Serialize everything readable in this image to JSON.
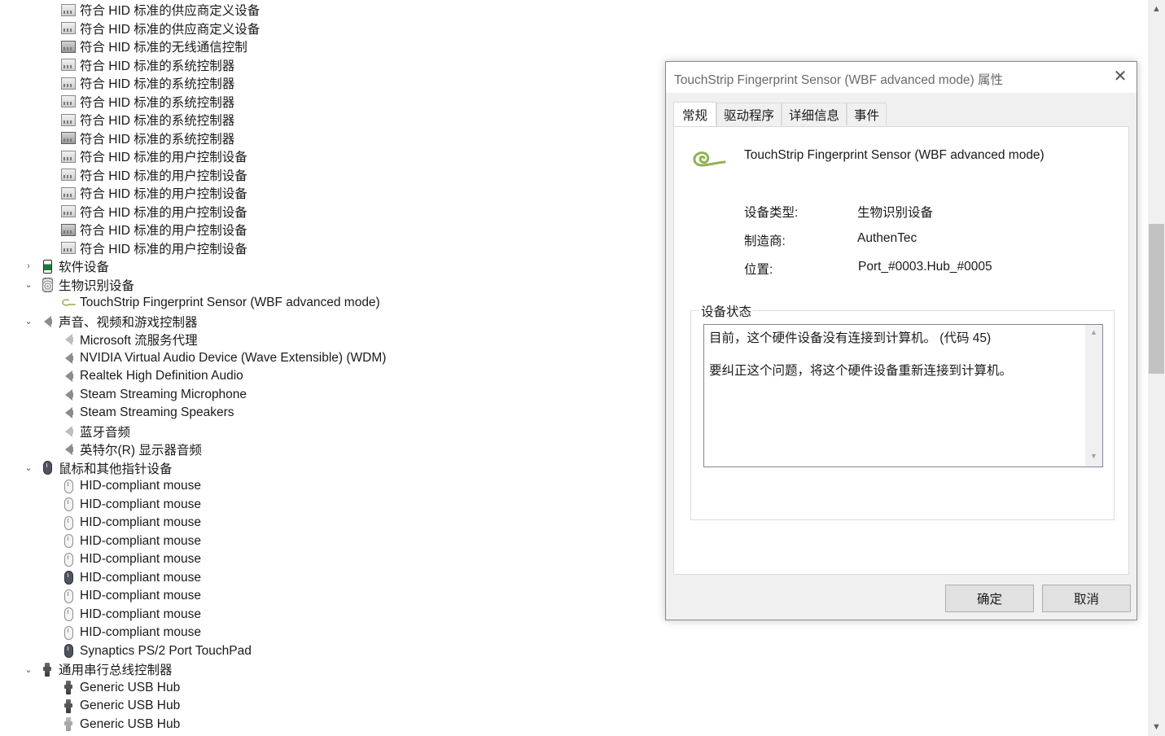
{
  "device_tree": {
    "rows": [
      {
        "level": 2,
        "icon": "hid-device-icon",
        "label": "符合 HID 标准的供应商定义设备"
      },
      {
        "level": 2,
        "icon": "hid-device-icon",
        "label": "符合 HID 标准的供应商定义设备"
      },
      {
        "level": 2,
        "icon": "hid-device-dark-icon",
        "label": "符合 HID 标准的无线通信控制"
      },
      {
        "level": 2,
        "icon": "hid-device-icon",
        "label": "符合 HID 标准的系统控制器"
      },
      {
        "level": 2,
        "icon": "hid-device-icon",
        "label": "符合 HID 标准的系统控制器"
      },
      {
        "level": 2,
        "icon": "hid-device-icon",
        "label": "符合 HID 标准的系统控制器"
      },
      {
        "level": 2,
        "icon": "hid-device-icon",
        "label": "符合 HID 标准的系统控制器"
      },
      {
        "level": 2,
        "icon": "hid-device-dark-icon",
        "label": "符合 HID 标准的系统控制器"
      },
      {
        "level": 2,
        "icon": "hid-device-icon",
        "label": "符合 HID 标准的用户控制设备"
      },
      {
        "level": 2,
        "icon": "hid-device-icon",
        "label": "符合 HID 标准的用户控制设备"
      },
      {
        "level": 2,
        "icon": "hid-device-icon",
        "label": "符合 HID 标准的用户控制设备"
      },
      {
        "level": 2,
        "icon": "hid-device-icon",
        "label": "符合 HID 标准的用户控制设备"
      },
      {
        "level": 2,
        "icon": "hid-device-dark-icon",
        "label": "符合 HID 标准的用户控制设备"
      },
      {
        "level": 2,
        "icon": "hid-device-icon",
        "label": "符合 HID 标准的用户控制设备"
      },
      {
        "level": 1,
        "chevron": "collapsed",
        "icon": "software-device-icon",
        "label": "软件设备"
      },
      {
        "level": 1,
        "chevron": "expanded",
        "icon": "biometric-device-icon",
        "label": "生物识别设备"
      },
      {
        "level": 2,
        "icon": "fingerprint-sensor-icon",
        "label": "TouchStrip Fingerprint Sensor (WBF advanced mode)"
      },
      {
        "level": 1,
        "chevron": "expanded",
        "icon": "speaker-icon",
        "label": "声音、视频和游戏控制器"
      },
      {
        "level": 2,
        "icon": "speaker-light-icon",
        "label": "Microsoft 流服务代理"
      },
      {
        "level": 2,
        "icon": "speaker-icon",
        "label": "NVIDIA Virtual Audio Device (Wave Extensible) (WDM)"
      },
      {
        "level": 2,
        "icon": "speaker-icon",
        "label": "Realtek High Definition Audio"
      },
      {
        "level": 2,
        "icon": "speaker-icon",
        "label": "Steam Streaming Microphone"
      },
      {
        "level": 2,
        "icon": "speaker-icon",
        "label": "Steam Streaming Speakers"
      },
      {
        "level": 2,
        "icon": "speaker-light-icon",
        "label": "蓝牙音频"
      },
      {
        "level": 2,
        "icon": "speaker-icon",
        "label": "英特尔(R) 显示器音频"
      },
      {
        "level": 1,
        "chevron": "expanded",
        "icon": "mouse-dark-icon",
        "label": "鼠标和其他指针设备"
      },
      {
        "level": 2,
        "icon": "mouse-icon",
        "label": "HID-compliant mouse"
      },
      {
        "level": 2,
        "icon": "mouse-icon",
        "label": "HID-compliant mouse"
      },
      {
        "level": 2,
        "icon": "mouse-icon",
        "label": "HID-compliant mouse"
      },
      {
        "level": 2,
        "icon": "mouse-icon",
        "label": "HID-compliant mouse"
      },
      {
        "level": 2,
        "icon": "mouse-icon",
        "label": "HID-compliant mouse"
      },
      {
        "level": 2,
        "icon": "mouse-dark-icon",
        "label": "HID-compliant mouse"
      },
      {
        "level": 2,
        "icon": "mouse-icon",
        "label": "HID-compliant mouse"
      },
      {
        "level": 2,
        "icon": "mouse-icon",
        "label": "HID-compliant mouse"
      },
      {
        "level": 2,
        "icon": "mouse-icon",
        "label": "HID-compliant mouse"
      },
      {
        "level": 2,
        "icon": "mouse-dark-icon",
        "label": "Synaptics PS/2 Port TouchPad"
      },
      {
        "level": 1,
        "chevron": "expanded",
        "icon": "usb-icon",
        "label": "通用串行总线控制器"
      },
      {
        "level": 2,
        "icon": "usb-icon",
        "label": "Generic USB Hub"
      },
      {
        "level": 2,
        "icon": "usb-icon",
        "label": "Generic USB Hub"
      },
      {
        "level": 2,
        "icon": "usb-light-icon",
        "label": "Generic USB Hub"
      }
    ]
  },
  "dialog": {
    "title": "TouchStrip Fingerprint Sensor (WBF advanced mode) 属性",
    "close_glyph": "✕",
    "tabs": [
      {
        "label": "常规",
        "active": true
      },
      {
        "label": "驱动程序",
        "active": false
      },
      {
        "label": "详细信息",
        "active": false
      },
      {
        "label": "事件",
        "active": false
      }
    ],
    "general": {
      "device_name": "TouchStrip Fingerprint Sensor (WBF advanced mode)",
      "device_icon": "fingerprint-sensor-icon",
      "properties": [
        {
          "label": "设备类型:",
          "value": "生物识别设备"
        },
        {
          "label": "制造商:",
          "value": "AuthenTec"
        },
        {
          "label": "位置:",
          "value": "Port_#0003.Hub_#0005"
        }
      ],
      "status_legend": "设备状态",
      "status_lines": [
        "目前，这个硬件设备没有连接到计算机。 (代码 45)",
        "要纠正这个问题，将这个硬件设备重新连接到计算机。"
      ]
    },
    "buttons": {
      "ok": "确定",
      "cancel": "取消"
    }
  },
  "scrollbar": {
    "up_glyph": "⌃",
    "down_glyph": "⌄"
  },
  "colors": {
    "fingerprint_accent": "#a6c27a",
    "dialog_bg": "#f0f0f0",
    "button_bg": "#e1e1e1"
  }
}
